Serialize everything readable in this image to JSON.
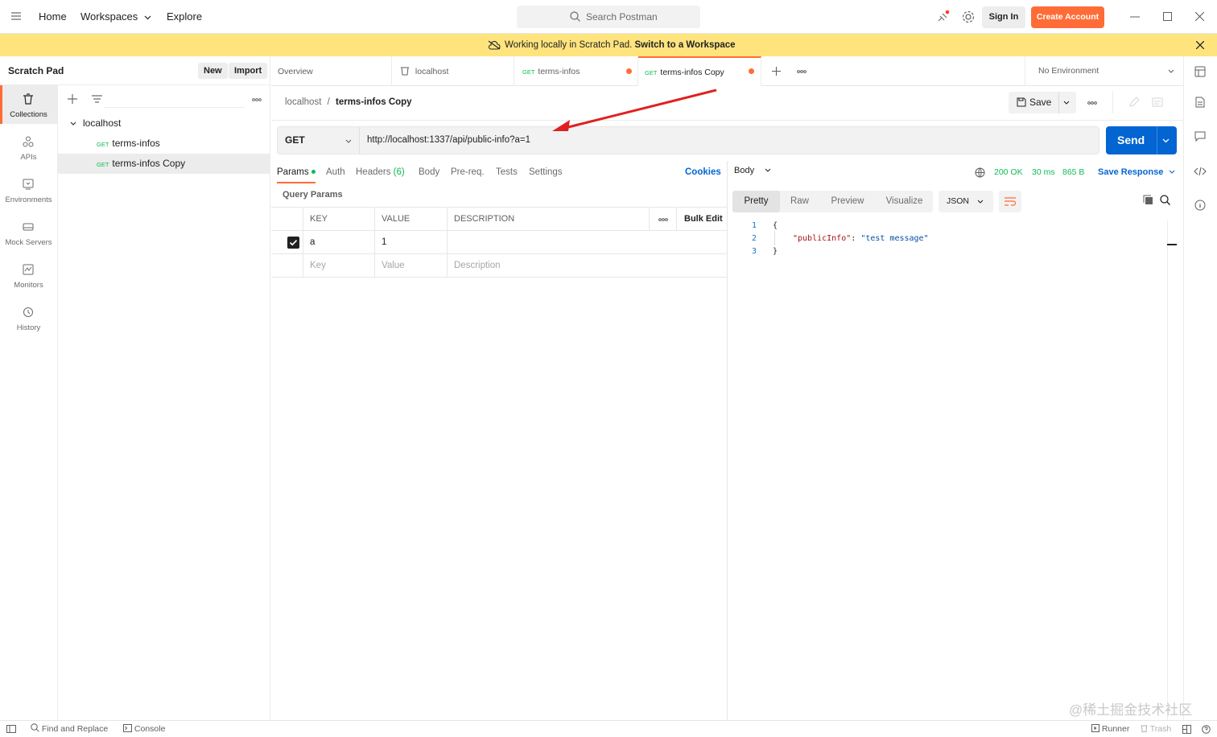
{
  "topbar": {
    "nav": [
      "Home",
      "Workspaces",
      "Explore"
    ],
    "search_placeholder": "Search Postman",
    "sign_in": "Sign In",
    "create_account": "Create Account"
  },
  "banner": {
    "text": "Working locally in Scratch Pad.",
    "link": "Switch to a Workspace"
  },
  "scratchpad": {
    "title": "Scratch Pad",
    "new": "New",
    "import": "Import"
  },
  "leftnav": [
    "Collections",
    "APIs",
    "Environments",
    "Mock Servers",
    "Monitors",
    "History"
  ],
  "tree": {
    "collection": "localhost",
    "items": [
      {
        "method": "GET",
        "name": "terms-infos"
      },
      {
        "method": "GET",
        "name": "terms-infos Copy"
      }
    ]
  },
  "tabs": [
    {
      "label": "Overview"
    },
    {
      "label": "localhost"
    },
    {
      "method": "GET",
      "label": "terms-infos"
    },
    {
      "method": "GET",
      "label": "terms-infos Copy"
    }
  ],
  "environment": "No Environment",
  "breadcrumb": {
    "parent": "localhost",
    "separator": "/",
    "current": "terms-infos Copy"
  },
  "save": "Save",
  "request": {
    "method": "GET",
    "url": "http://localhost:1337/api/public-info?a=1",
    "send": "Send"
  },
  "request_tabs": [
    "Params",
    "Auth",
    "Headers",
    "(6)",
    "Body",
    "Pre-req.",
    "Tests",
    "Settings"
  ],
  "cookies": "Cookies",
  "query_params_label": "Query Params",
  "params_table": {
    "headers": [
      "KEY",
      "VALUE",
      "DESCRIPTION"
    ],
    "bulk_edit": "Bulk Edit",
    "rows": [
      {
        "key": "a",
        "value": "1",
        "description": ""
      }
    ],
    "placeholders": {
      "key": "Key",
      "value": "Value",
      "description": "Description"
    }
  },
  "response": {
    "body_label": "Body",
    "status": "200 OK",
    "time": "30 ms",
    "size": "865 B",
    "save_response": "Save Response",
    "views": [
      "Pretty",
      "Raw",
      "Preview",
      "Visualize"
    ],
    "format": "JSON",
    "lines": [
      "1",
      "2",
      "3"
    ],
    "json_open": "{",
    "json_key": "\"publicInfo\"",
    "json_colon": ":",
    "json_value": "\"test message\"",
    "json_close": "}"
  },
  "statusbar": {
    "find_replace": "Find and Replace",
    "console": "Console",
    "runner": "Runner",
    "trash": "Trash"
  },
  "watermark": "@稀土掘金技术社区",
  "colors": {
    "accent": "#ff6c37",
    "primary": "#0265d2",
    "banner": "#ffe47e",
    "get": "#0cbb52"
  }
}
